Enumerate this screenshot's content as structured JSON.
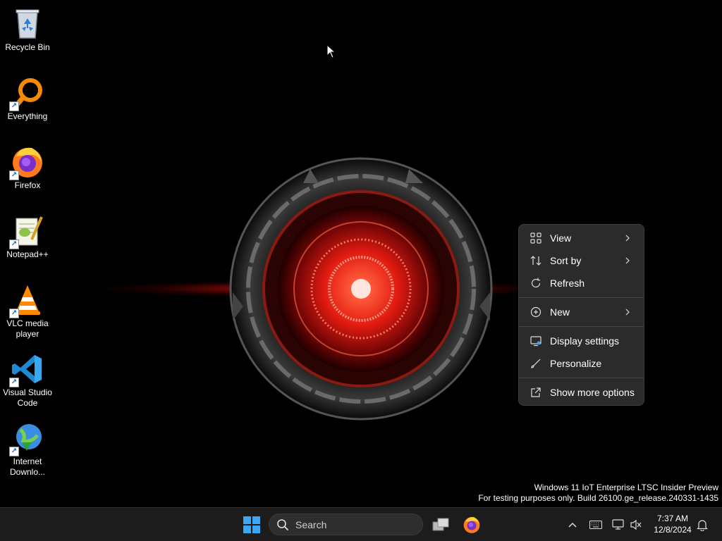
{
  "desktop_icons": [
    {
      "label": "Recycle Bin",
      "icon": "recycle-bin-icon"
    },
    {
      "label": "Everything",
      "icon": "everything-search-icon"
    },
    {
      "label": "Firefox",
      "icon": "firefox-icon"
    },
    {
      "label": "Notepad++",
      "icon": "notepad-plus-plus-icon"
    },
    {
      "label": "VLC media player",
      "icon": "vlc-icon"
    },
    {
      "label": "Visual Studio Code",
      "icon": "vscode-icon"
    },
    {
      "label": "Internet Downlo...",
      "icon": "internet-download-manager-icon"
    }
  ],
  "context_menu": {
    "items": [
      {
        "label": "View",
        "icon": "grid-icon",
        "submenu": true
      },
      {
        "label": "Sort by",
        "icon": "sort-icon",
        "submenu": true
      },
      {
        "label": "Refresh",
        "icon": "refresh-icon",
        "submenu": false
      },
      {
        "label": "New",
        "icon": "plus-circle-icon",
        "submenu": true
      },
      {
        "label": "Display settings",
        "icon": "display-icon",
        "submenu": false
      },
      {
        "label": "Personalize",
        "icon": "brush-icon",
        "submenu": false
      },
      {
        "label": "Show more options",
        "icon": "external-icon",
        "submenu": false
      }
    ]
  },
  "watermark": {
    "line1": "Windows 11 IoT Enterprise LTSC Insider Preview",
    "line2": "For testing purposes only. Build 26100.ge_release.240331-1435"
  },
  "taskbar": {
    "search_placeholder": "Search",
    "time": "7:37 AM",
    "date": "12/8/2024"
  },
  "colors": {
    "taskbar_bg": "#1c1c1c",
    "menu_bg": "#2b2b2b",
    "accent": "#3aa0ff",
    "wallpaper_glow": "#ff2a1a"
  }
}
